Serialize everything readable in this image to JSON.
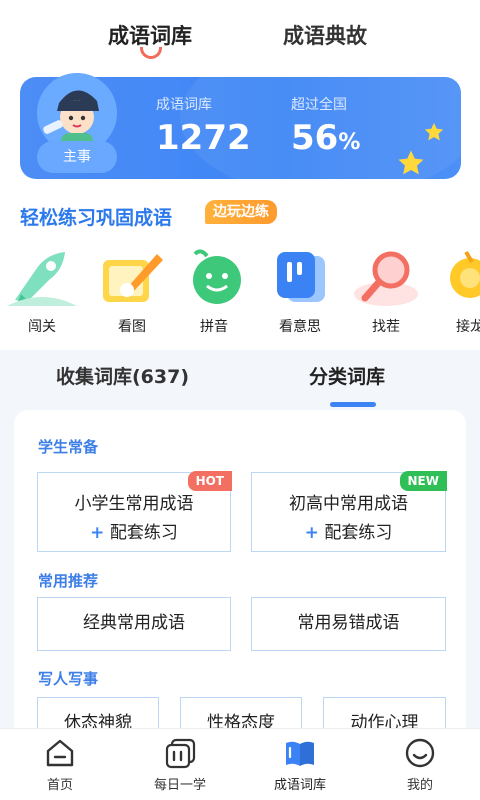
{
  "top_tabs": {
    "tab1": "成语词库",
    "tab2": "成语典故"
  },
  "stats": {
    "avatar_label": "主事",
    "label1": "成语词库",
    "value1": "1272",
    "label2": "超过全国",
    "value2": "56",
    "value2_unit": "%"
  },
  "practice": {
    "title": "轻松练习巩固成语",
    "badge": "边玩边练",
    "items": [
      {
        "label": "闯关",
        "icon": "rocket-icon"
      },
      {
        "label": "看图",
        "icon": "paintbrush-icon"
      },
      {
        "label": "拼音",
        "icon": "pinyin-face-icon"
      },
      {
        "label": "看意思",
        "icon": "cards-icon"
      },
      {
        "label": "找茬",
        "icon": "magnifier-icon"
      },
      {
        "label": "接龙",
        "icon": "chain-icon"
      }
    ]
  },
  "library": {
    "tab_collected": "收集词库(637)",
    "tab_category": "分类词库",
    "sections": [
      {
        "title": "学生常备",
        "boxes": [
          {
            "line1": "小学生常用成语",
            "line2": "配套练习",
            "tag": "HOT"
          },
          {
            "line1": "初高中常用成语",
            "line2": "配套练习",
            "tag": "NEW"
          }
        ]
      },
      {
        "title": "常用推荐",
        "boxes": [
          {
            "line1": "经典常用成语"
          },
          {
            "line1": "常用易错成语"
          }
        ]
      },
      {
        "title": "写人写事",
        "boxes": [
          {
            "line1": "休态神貌"
          },
          {
            "line1": "性格态度"
          },
          {
            "line1": "动作心理"
          }
        ]
      }
    ],
    "plus_symbol": "+"
  },
  "bottom_nav": [
    {
      "label": "首页",
      "icon": "home-icon"
    },
    {
      "label": "每日一学",
      "icon": "daily-icon"
    },
    {
      "label": "成语词库",
      "icon": "book-icon",
      "active": true
    },
    {
      "label": "我的",
      "icon": "profile-icon"
    }
  ],
  "colors": {
    "accent": "#3c84f3",
    "hot": "#f26f62",
    "new": "#2fbf56",
    "badge": "#ffa530"
  }
}
